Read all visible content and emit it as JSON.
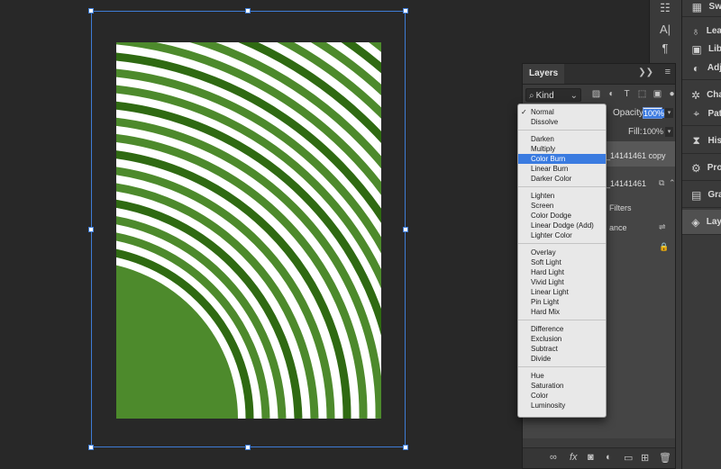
{
  "layers_panel": {
    "tab": "Layers",
    "kind_filter": "Kind",
    "opacity_label": "Opacity:",
    "opacity_value": "100%",
    "fill_label": "Fill:",
    "fill_value": "100%",
    "layers": [
      {
        "name": "_14141461 copy",
        "selected": true
      },
      {
        "name": "_14141461",
        "selected": false
      }
    ],
    "smart_filters_label": "Filters",
    "filter_item_label": "ance"
  },
  "blend_modes": {
    "selected": "Color Burn",
    "checked": "Normal",
    "groups": [
      [
        "Normal",
        "Dissolve"
      ],
      [
        "Darken",
        "Multiply",
        "Color Burn",
        "Linear Burn",
        "Darker Color"
      ],
      [
        "Lighten",
        "Screen",
        "Color Dodge",
        "Linear Dodge (Add)",
        "Lighter Color"
      ],
      [
        "Overlay",
        "Soft Light",
        "Hard Light",
        "Vivid Light",
        "Linear Light",
        "Pin Light",
        "Hard Mix"
      ],
      [
        "Difference",
        "Exclusion",
        "Subtract",
        "Divide"
      ],
      [
        "Hue",
        "Saturation",
        "Color",
        "Luminosity"
      ]
    ]
  },
  "dock": {
    "items": [
      {
        "label": "Sw",
        "icon": "grid-icon"
      },
      {
        "label": "Lea",
        "icon": "lightbulb-icon"
      },
      {
        "label": "Lib",
        "icon": "library-icon"
      },
      {
        "label": "Adj",
        "icon": "adjustments-icon"
      },
      {
        "label": "Cha",
        "icon": "channels-icon"
      },
      {
        "label": "Pat",
        "icon": "paths-icon"
      },
      {
        "label": "His",
        "icon": "history-icon"
      },
      {
        "label": "Pro",
        "icon": "properties-icon"
      },
      {
        "label": "Gra",
        "icon": "gradient-icon"
      },
      {
        "label": "Lay",
        "icon": "layers-icon"
      }
    ]
  },
  "colors": {
    "artwork_green": "#4d8a2c",
    "artwork_green_dark": "#2f6a12",
    "selection_blue": "#3a7be0",
    "transform_box": "#3e7cd6"
  }
}
